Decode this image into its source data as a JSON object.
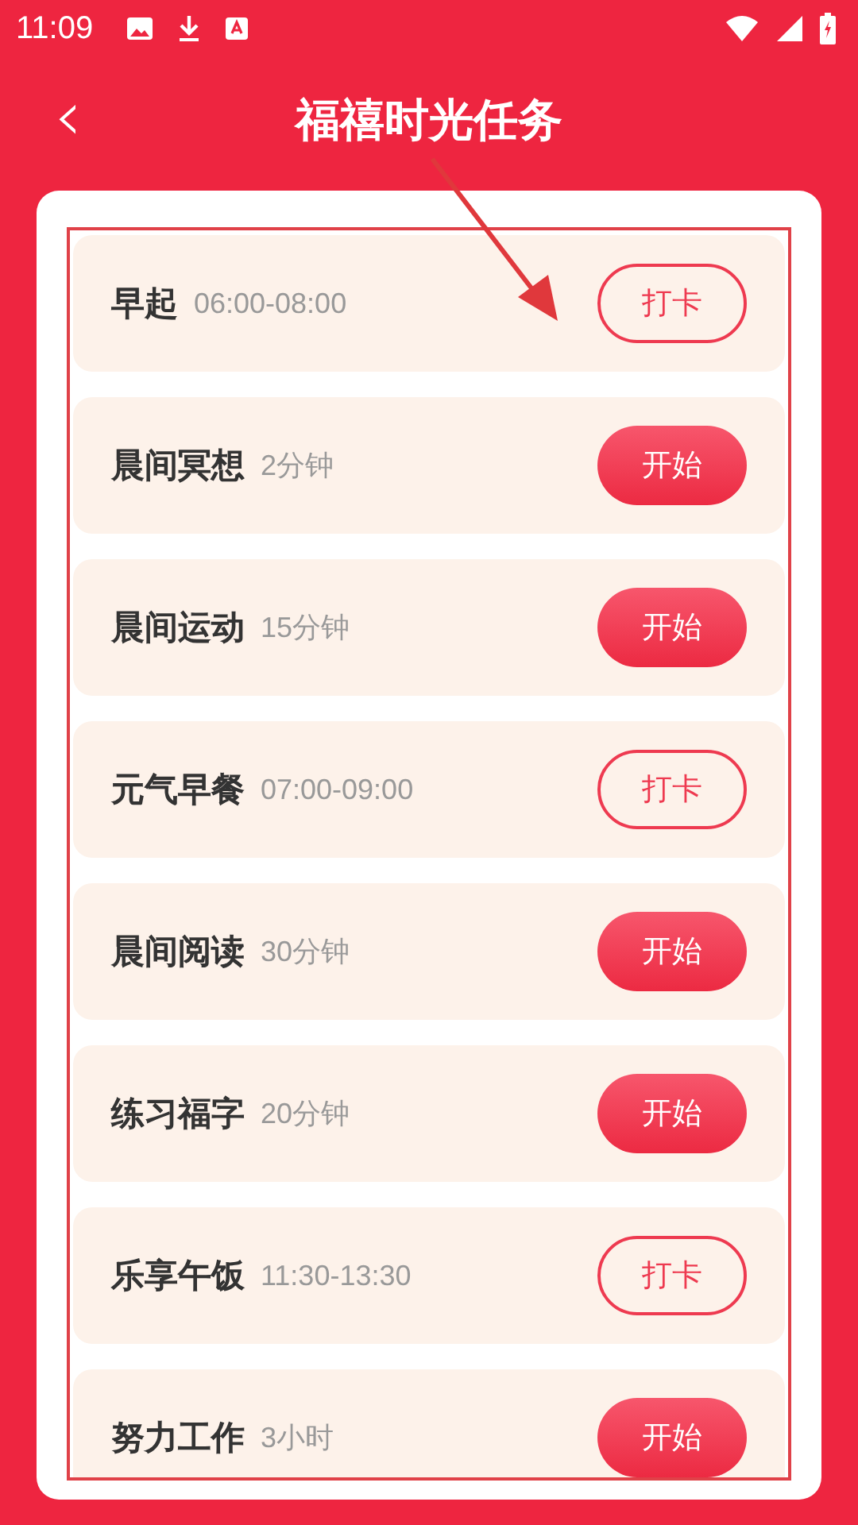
{
  "status_bar": {
    "time": "11:09"
  },
  "header": {
    "back": "‹",
    "title": "福禧时光任务"
  },
  "tasks": [
    {
      "name": "早起",
      "detail": "06:00-08:00",
      "kind": "checkin",
      "action": "打卡"
    },
    {
      "name": "晨间冥想",
      "detail": "2分钟",
      "kind": "start",
      "action": "开始"
    },
    {
      "name": "晨间运动",
      "detail": "15分钟",
      "kind": "start",
      "action": "开始"
    },
    {
      "name": "元气早餐",
      "detail": "07:00-09:00",
      "kind": "checkin",
      "action": "打卡"
    },
    {
      "name": "晨间阅读",
      "detail": "30分钟",
      "kind": "start",
      "action": "开始"
    },
    {
      "name": "练习福字",
      "detail": "20分钟",
      "kind": "start",
      "action": "开始"
    },
    {
      "name": "乐享午饭",
      "detail": "11:30-13:30",
      "kind": "checkin",
      "action": "打卡"
    },
    {
      "name": "努力工作",
      "detail": "3小时",
      "kind": "start",
      "action": "开始"
    }
  ]
}
